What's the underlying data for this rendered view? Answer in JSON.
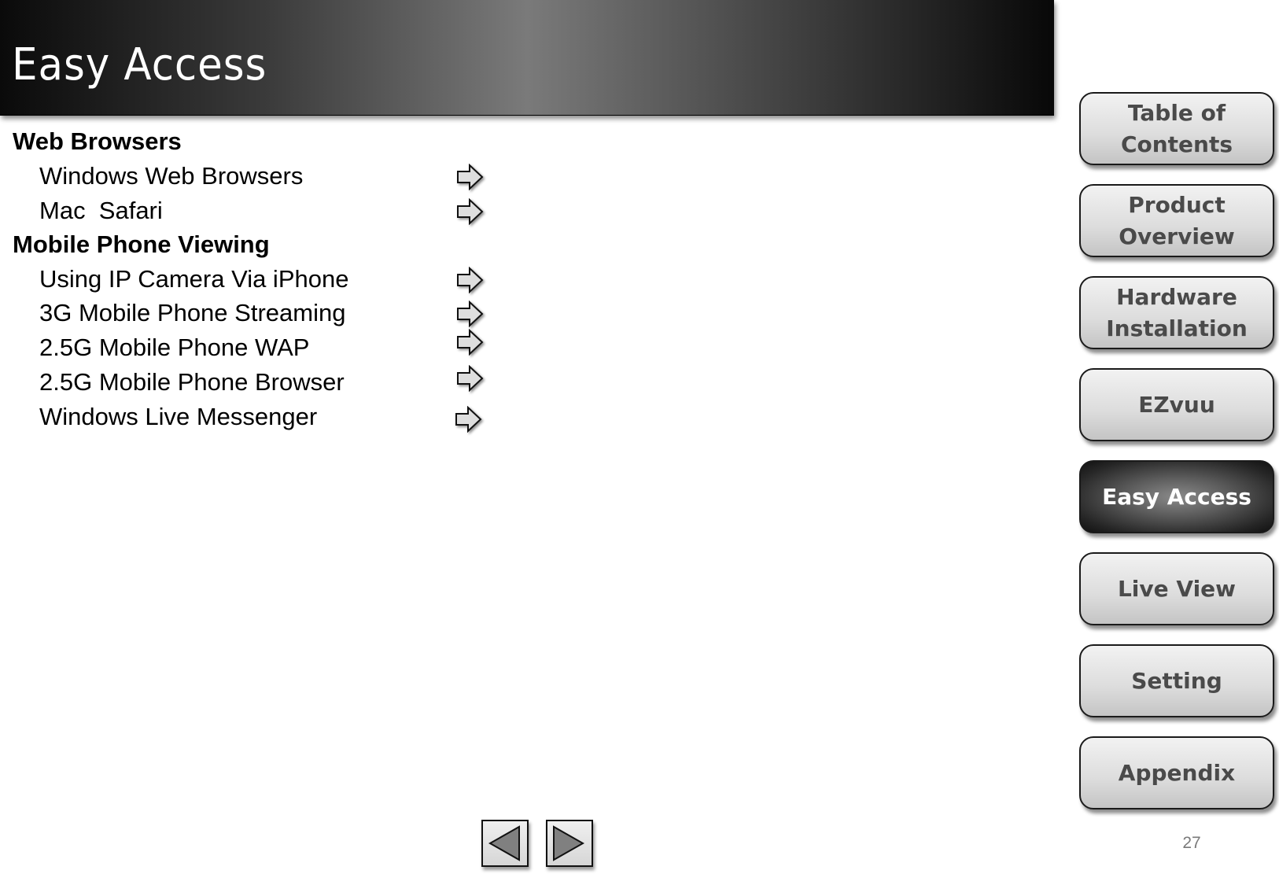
{
  "header": {
    "title": "Easy Access"
  },
  "content": {
    "sections": [
      {
        "heading": "Web Browsers",
        "items": [
          {
            "label": "Windows Web Browsers",
            "icon": "arrow-right-icon"
          },
          {
            "label": "Mac  Safari",
            "icon": "arrow-right-icon"
          }
        ]
      },
      {
        "heading": "Mobile Phone Viewing",
        "items": [
          {
            "label": "Using IP Camera Via iPhone",
            "icon": "arrow-right-icon"
          },
          {
            "label": "3G Mobile Phone Streaming",
            "icon": "arrow-right-icon"
          },
          {
            "label": "2.5G Mobile Phone WAP",
            "icon": "arrow-right-icon"
          },
          {
            "label": "2.5G Mobile Phone Browser",
            "icon": "arrow-right-icon"
          },
          {
            "label": "Windows Live Messenger",
            "icon": "arrow-right-icon"
          }
        ]
      }
    ]
  },
  "side_nav": {
    "items": [
      {
        "label": "Table of\nContents",
        "active": false
      },
      {
        "label": "Product\nOverview",
        "active": false
      },
      {
        "label": "Hardware\nInstallation",
        "active": false
      },
      {
        "label": "EZvuu",
        "active": false
      },
      {
        "label": "Easy Access",
        "active": true
      },
      {
        "label": "Live View",
        "active": false
      },
      {
        "label": "Setting",
        "active": false
      },
      {
        "label": "Appendix",
        "active": false
      }
    ]
  },
  "pager": {
    "prev_icon": "triangle-left-icon",
    "next_icon": "triangle-right-icon",
    "page_number": "27"
  }
}
